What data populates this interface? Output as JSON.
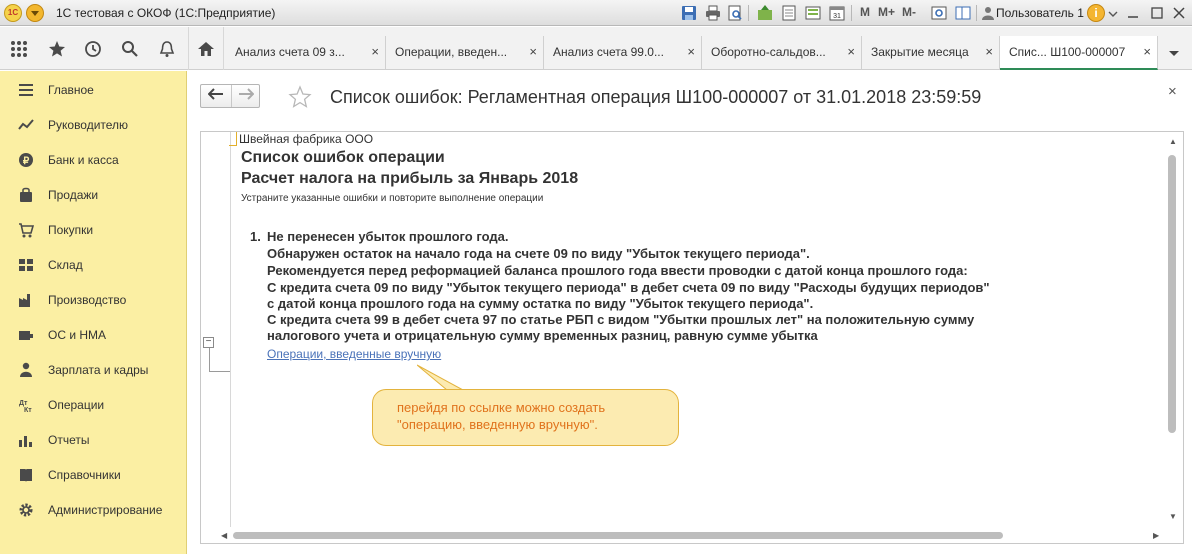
{
  "titlebar": {
    "app_title": "1С тестовая с ОКОФ  (1С:Предприятие)",
    "logo_text": "1С",
    "m_buttons": [
      "M",
      "M+",
      "M-"
    ],
    "user": "Пользователь 1"
  },
  "tabs": [
    {
      "label": "Анализ счета 09 з...",
      "close": "×"
    },
    {
      "label": "Операции, введен...",
      "close": "×"
    },
    {
      "label": "Анализ счета 99.0...",
      "close": "×"
    },
    {
      "label": "Оборотно-сальдов...",
      "close": "×"
    },
    {
      "label": "Закрытие месяца",
      "close": "×"
    },
    {
      "label": "Спис...   Ш100-000007",
      "close": "×"
    }
  ],
  "sidebar": {
    "items": [
      {
        "label": "Главное",
        "icon": "menu-lines-icon"
      },
      {
        "label": "Руководителю",
        "icon": "trend-icon"
      },
      {
        "label": "Банк и касса",
        "icon": "ruble-coin-icon"
      },
      {
        "label": "Продажи",
        "icon": "shopping-bag-icon"
      },
      {
        "label": "Покупки",
        "icon": "cart-icon"
      },
      {
        "label": "Склад",
        "icon": "warehouse-icon"
      },
      {
        "label": "Производство",
        "icon": "factory-icon"
      },
      {
        "label": "ОС и НМА",
        "icon": "assets-icon"
      },
      {
        "label": "Зарплата и кадры",
        "icon": "person-icon"
      },
      {
        "label": "Операции",
        "icon": "dt-kt-icon"
      },
      {
        "label": "Отчеты",
        "icon": "bar-chart-icon"
      },
      {
        "label": "Справочники",
        "icon": "book-icon"
      },
      {
        "label": "Администрирование",
        "icon": "gear-icon"
      }
    ]
  },
  "form": {
    "title": "Список ошибок: Регламентная операция Ш100-000007 от 31.01.2018 23:59:59",
    "close": "×",
    "nav_back": "🡐",
    "nav_forward": "🡒"
  },
  "document": {
    "organization": "Швейная фабрика ООО",
    "heading": "Список ошибок операции",
    "subheading": "Расчет налога на прибыль за Январь 2018",
    "hint": "Устраните указанные ошибки и повторите выполнение операции",
    "error_number": "1.",
    "error_lines": [
      "Не перенесен убыток прошлого года.",
      "Обнаружен остаток на начало года на счете 09 по виду \"Убыток текущего периода\".",
      "Рекомендуется перед реформацией баланса прошлого года ввести проводки с датой конца прошлого года:",
      "С кредита счета 09 по виду \"Убыток текущего периода\" в дебет счета 09 по виду \"Расходы будущих периодов\"",
      "с датой конца прошлого года на сумму остатка по виду \"Убыток текущего периода\".",
      "С кредита счета 99 в дебет счета 97 по статье РБП с видом \"Убытки прошлых лет\" на положительную сумму",
      "налогового учета и отрицательную сумму временных разниц, равную сумме убытка"
    ],
    "link": "Операции, введенные вручную",
    "collapse_symbol": "−"
  },
  "callout": {
    "line1": "перейдя по ссылке можно создать",
    "line2": "\"операцию, введенную вручную\"."
  },
  "colors": {
    "sidebar_bg": "#fbefa3",
    "link": "#4a72b8",
    "callout_bg": "#fcebb1",
    "callout_text": "#e0731d",
    "active_tab_underline": "#2e8b57"
  }
}
